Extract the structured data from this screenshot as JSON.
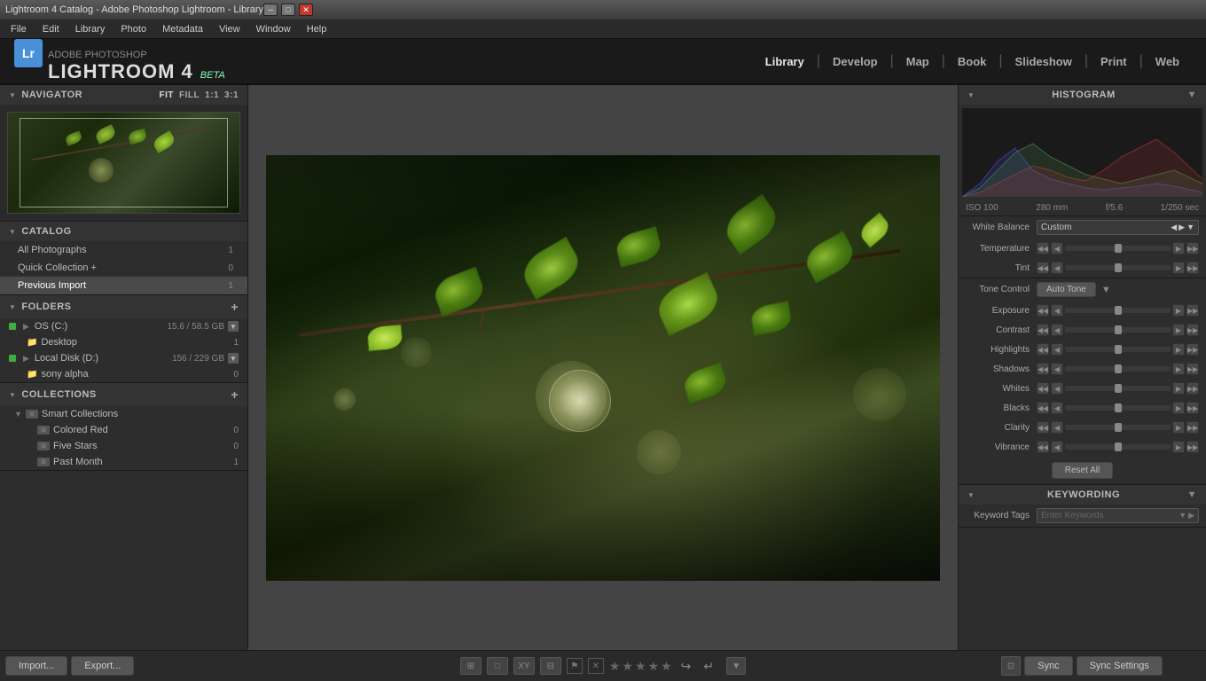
{
  "titlebar": {
    "title": "Lightroom 4 Catalog - Adobe Photoshop Lightroom - Library"
  },
  "menubar": {
    "items": [
      "File",
      "Edit",
      "Library",
      "Photo",
      "Metadata",
      "View",
      "Window",
      "Help"
    ]
  },
  "brand": {
    "badge": "Lr",
    "subtitle": "ADOBE PHOTOSHOP",
    "name": "LIGHTROOM 4",
    "beta": "BETA"
  },
  "nav": {
    "items": [
      "Library",
      "Develop",
      "Map",
      "Book",
      "Slideshow",
      "Print",
      "Web"
    ],
    "active": "Library"
  },
  "navigator": {
    "title": "Navigator",
    "modes": [
      "FIT",
      "FILL",
      "1:1",
      "3:1"
    ]
  },
  "catalog": {
    "title": "Catalog",
    "items": [
      {
        "name": "All Photographs",
        "count": "1"
      },
      {
        "name": "Quick Collection +",
        "count": "0"
      },
      {
        "name": "Previous Import",
        "count": "1",
        "active": true
      }
    ]
  },
  "folders": {
    "title": "Folders",
    "items": [
      {
        "name": "OS (C:)",
        "size": "15.6 / 58.5 GB",
        "level": 0
      },
      {
        "name": "Desktop",
        "count": "1",
        "level": 1
      },
      {
        "name": "Local Disk (D:)",
        "size": "156 / 229 GB",
        "level": 0
      },
      {
        "name": "sony alpha",
        "count": "0",
        "level": 1
      }
    ]
  },
  "collections": {
    "title": "Collections",
    "groups": [
      {
        "name": "Smart Collections",
        "items": [
          {
            "name": "Colored Red",
            "count": "0"
          },
          {
            "name": "Five Stars",
            "count": "0"
          },
          {
            "name": "Past Month",
            "count": "1"
          }
        ]
      }
    ]
  },
  "histogram": {
    "title": "Histogram",
    "iso": "ISO 100",
    "focal": "280 mm",
    "aperture": "f/5.6",
    "shutter": "1/250 sec"
  },
  "develop": {
    "white_balance": {
      "label": "White Balance",
      "value": "Custom"
    },
    "temperature": {
      "label": "Temperature"
    },
    "tint": {
      "label": "Tint"
    },
    "tone_control": {
      "label": "Tone Control",
      "auto_btn": "Auto Tone"
    },
    "exposure": {
      "label": "Exposure"
    },
    "contrast": {
      "label": "Contrast"
    },
    "highlights": {
      "label": "Highlights"
    },
    "shadows": {
      "label": "Shadows"
    },
    "whites": {
      "label": "Whites"
    },
    "blacks": {
      "label": "Blacks"
    },
    "clarity": {
      "label": "Clarity"
    },
    "vibrance": {
      "label": "Vibrance"
    },
    "reset_btn": "Reset All"
  },
  "keywording": {
    "title": "Keywording",
    "label": "Keyword Tags",
    "placeholder": "Enter Keywords"
  },
  "bottom": {
    "import_btn": "Import...",
    "export_btn": "Export...",
    "sync_btn": "Sync",
    "sync_settings_btn": "Sync Settings",
    "stars": [
      "★",
      "★",
      "★",
      "★",
      "★"
    ]
  }
}
